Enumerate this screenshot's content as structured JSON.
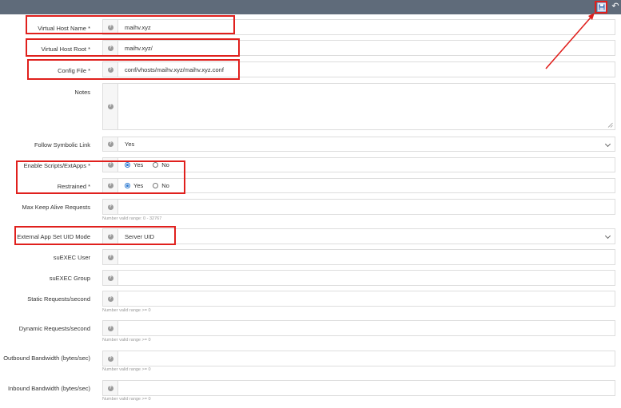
{
  "toolbar": {
    "save_icon": "save-icon",
    "undo_icon": "undo-icon",
    "undo_glyph": "↶"
  },
  "help_glyph": "?",
  "fields": {
    "vhost_name": {
      "label": "Virtual Host Name *",
      "value": "maihv.xyz"
    },
    "vhost_root": {
      "label": "Virtual Host Root *",
      "value": "maihv.xyz/"
    },
    "config_file": {
      "label": "Config File *",
      "value": "conf/vhosts/maihv.xyz/maihv.xyz.conf"
    },
    "notes": {
      "label": "Notes",
      "value": ""
    },
    "follow_symlink": {
      "label": "Follow Symbolic Link",
      "value": "Yes"
    },
    "enable_scripts": {
      "label": "Enable Scripts/ExtApps *",
      "options": [
        "Yes",
        "No"
      ],
      "selected": "Yes"
    },
    "restrained": {
      "label": "Restrained *",
      "options": [
        "Yes",
        "No"
      ],
      "selected": "Yes"
    },
    "max_keep_alive": {
      "label": "Max Keep Alive Requests",
      "value": "",
      "hint": "Number valid range: 0 - 32767"
    },
    "ext_app_uid_mode": {
      "label": "External App Set UID Mode",
      "value": "Server UID"
    },
    "suexec_user": {
      "label": "suEXEC User",
      "value": ""
    },
    "suexec_group": {
      "label": "suEXEC Group",
      "value": ""
    },
    "static_requests": {
      "label": "Static Requests/second",
      "value": "",
      "hint": "Number valid range >= 0"
    },
    "dynamic_requests": {
      "label": "Dynamic Requests/second",
      "value": "",
      "hint": "Number valid range >= 0"
    },
    "outbound_bw": {
      "label": "Outbound Bandwidth (bytes/sec)",
      "value": "",
      "hint": "Number valid range >= 0"
    },
    "inbound_bw": {
      "label": "Inbound Bandwidth (bytes/sec)",
      "value": "",
      "hint": "Number valid range >= 0"
    }
  },
  "colors": {
    "topbar": "#5f6b7a",
    "annotation": "#e0201d",
    "radio_selected": "#2f7bd1"
  }
}
